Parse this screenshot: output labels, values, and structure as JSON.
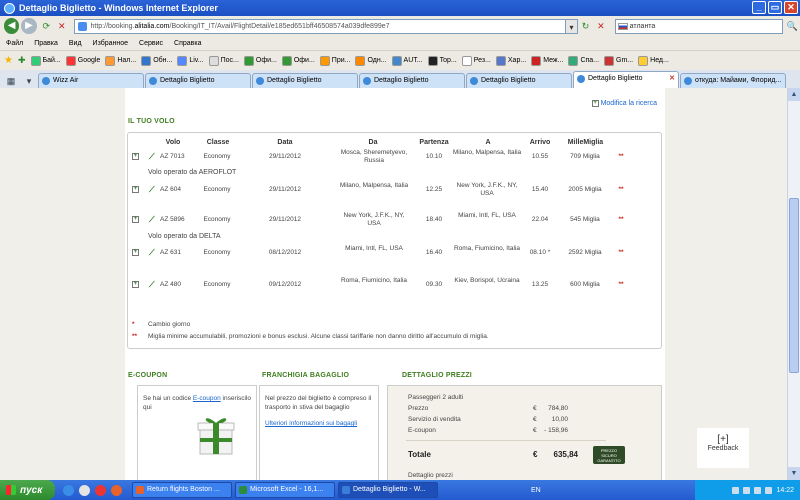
{
  "window": {
    "title": "Dettaglio Biglietto - Windows Internet Explorer"
  },
  "address": {
    "url_prefix": "http://booking.",
    "url_domain": "alitalia.com",
    "url_rest": "/Booking/IT_IT/Avail/FlightDetail/e185ed651bff46508574a039dfe899e7",
    "search_text": "атланта"
  },
  "menu": [
    "Файл",
    "Правка",
    "Вид",
    "Избранное",
    "Сервис",
    "Справка"
  ],
  "favorites": [
    {
      "label": "Бай...",
      "color": "#3c7"
    },
    {
      "label": "Google",
      "color": "#f33"
    },
    {
      "label": "Нал...",
      "color": "#f93"
    },
    {
      "label": "Обн...",
      "color": "#37c"
    },
    {
      "label": "Liv...",
      "color": "#58f"
    },
    {
      "label": "Пос...",
      "color": "#ddd"
    },
    {
      "label": "Офи...",
      "color": "#393"
    },
    {
      "label": "Офи...",
      "color": "#393"
    },
    {
      "label": "При...",
      "color": "#f90"
    },
    {
      "label": "Одн...",
      "color": "#f80"
    },
    {
      "label": "AUT...",
      "color": "#48c"
    },
    {
      "label": "Top...",
      "color": "#222"
    },
    {
      "label": "Рез...",
      "color": "#fff"
    },
    {
      "label": "Хар...",
      "color": "#57c"
    },
    {
      "label": "Меж...",
      "color": "#c22"
    },
    {
      "label": "Спа...",
      "color": "#3a7"
    },
    {
      "label": "Gm...",
      "color": "#c33"
    },
    {
      "label": "Нед...",
      "color": "#fc3"
    }
  ],
  "tabs": [
    {
      "label": "Wizz Air",
      "active": false
    },
    {
      "label": "Dettaglio Biglietto",
      "active": false
    },
    {
      "label": "Dettaglio Biglietto",
      "active": false
    },
    {
      "label": "Dettaglio Biglietto",
      "active": false
    },
    {
      "label": "Dettaglio Biglietto",
      "active": false
    },
    {
      "label": "Dettaglio Biglietto",
      "active": true
    },
    {
      "label": "откуда: Майами, Флорид...",
      "active": false
    }
  ],
  "page": {
    "modify_link": "Modifica la ricerca",
    "section_title": "IL TUO VOLO",
    "headers": {
      "volo": "Volo",
      "classe": "Classe",
      "data": "Data",
      "da": "Da",
      "partenza": "Partenza",
      "a": "A",
      "arrivo": "Arrivo",
      "miglia": "MilleMiglia"
    },
    "flights": [
      {
        "volo": "AZ 7013",
        "classe": "Economy",
        "data": "29/11/2012",
        "da": "Mosca, Sheremetyevo, Russia",
        "partenza": "10.10",
        "a": "Milano, Malpensa, Italia",
        "arrivo": "10.55",
        "miglia": "709 Miglia",
        "mark": "**",
        "operated": "Volo operato da AEROFLOT"
      },
      {
        "volo": "AZ 604",
        "classe": "Economy",
        "data": "29/11/2012",
        "da": "Milano, Malpensa, Italia",
        "partenza": "12.25",
        "a": "New York, J.F.K., NY, USA",
        "arrivo": "15.40",
        "miglia": "2005 Miglia",
        "mark": "**",
        "operated": ""
      },
      {
        "volo": "AZ 5896",
        "classe": "Economy",
        "data": "29/11/2012",
        "da": "New York, J.F.K., NY, USA",
        "partenza": "18.40",
        "a": "Miami, Intl, FL, USA",
        "arrivo": "22.04",
        "miglia": "545 Miglia",
        "mark": "**",
        "operated": "Volo operato da DELTA"
      },
      {
        "volo": "AZ 631",
        "classe": "Economy",
        "data": "08/12/2012",
        "da": "Miami, Intl, FL, USA",
        "partenza": "16.40",
        "a": "Roma, Fiumicino, Italia",
        "arrivo": "08.10 *",
        "miglia": "2592 Miglia",
        "mark": "**",
        "operated": ""
      },
      {
        "volo": "AZ 480",
        "classe": "Economy",
        "data": "09/12/2012",
        "da": "Roma, Fiumicino, Italia",
        "partenza": "09.30",
        "a": "Kiev, Borispol, Ucraina",
        "arrivo": "13.25",
        "miglia": "600 Miglia",
        "mark": "**",
        "operated": ""
      }
    ],
    "notes": [
      {
        "mark": "*",
        "text": "Cambio giorno"
      },
      {
        "mark": "**",
        "text": "Miglia minime accumulabili, promozioni e bonus esclusi. Alcune classi tariffarie non danno diritto all'accumulo di miglia."
      }
    ],
    "ecoupon": {
      "title": "E-COUPON",
      "text_before": "Se hai un codice",
      "link": "E-coupon",
      "text_after": "inseriscilo qui"
    },
    "bagaglio": {
      "title": "FRANCHIGIA BAGAGLIO",
      "text": "Nel prezzo del biglietto è compreso il trasporto in stiva del bagaglio",
      "link": "Ulteriori informazioni sui bagagli"
    },
    "prezzi": {
      "title": "DETTAGLIO PREZZI",
      "passengers": "Passeggeri  2 adulti",
      "rows": [
        {
          "label": "Prezzo",
          "cur": "€",
          "value": "784,80"
        },
        {
          "label": "Servizio di vendita",
          "cur": "€",
          "value": "10,00"
        },
        {
          "label": "E-coupon",
          "cur": "€",
          "value": "- 158,96"
        }
      ],
      "total_label": "Totale",
      "total_cur": "€",
      "total_value": "635,84",
      "more": "Dettaglio prezzi",
      "seal": "PREZZO SICURO GARANTITO"
    },
    "feedback": {
      "icon": "[+]",
      "label": "Feedback"
    }
  },
  "taskbar": {
    "start": "пуск",
    "tasks": [
      {
        "label": "Return flights Boston ...",
        "color": "#e8622a",
        "active": false
      },
      {
        "label": "Microsoft Excel - 16,1...",
        "color": "#2e8b3a",
        "active": false
      },
      {
        "label": "Dettaglio Biglietto - W...",
        "color": "#3a7ed8",
        "active": true
      }
    ],
    "lang": "EN",
    "time": "14:22"
  }
}
